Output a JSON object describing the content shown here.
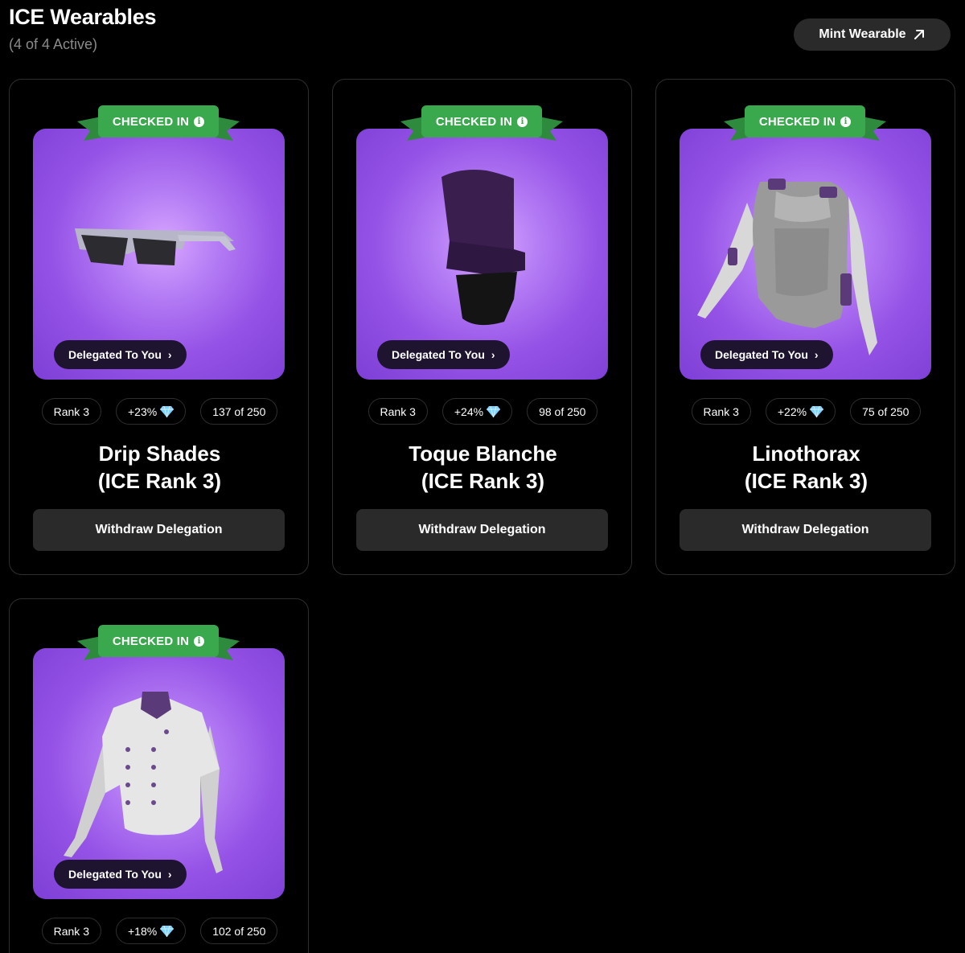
{
  "header": {
    "title": "ICE Wearables",
    "subtitle": "(4 of 4 Active)",
    "mint_label": "Mint Wearable"
  },
  "cards": [
    {
      "status": "CHECKED IN",
      "delegated_label": "Delegated To You",
      "rank": "Rank 3",
      "bonus": "+23%",
      "count": "137 of 250",
      "name": "Drip Shades",
      "rank_title": "(ICE Rank 3)",
      "withdraw_label": "Withdraw Delegation",
      "image": "sunglasses"
    },
    {
      "status": "CHECKED IN",
      "delegated_label": "Delegated To You",
      "rank": "Rank 3",
      "bonus": "+24%",
      "count": "98 of 250",
      "name": "Toque Blanche",
      "rank_title": "(ICE Rank 3)",
      "withdraw_label": "Withdraw Delegation",
      "image": "chef-hat"
    },
    {
      "status": "CHECKED IN",
      "delegated_label": "Delegated To You",
      "rank": "Rank 3",
      "bonus": "+22%",
      "count": "75 of 250",
      "name": "Linothorax",
      "rank_title": "(ICE Rank 3)",
      "withdraw_label": "Withdraw Delegation",
      "image": "armor"
    },
    {
      "status": "CHECKED IN",
      "delegated_label": "Delegated To You",
      "rank": "Rank 3",
      "bonus": "+18%",
      "count": "102 of 250",
      "name": "",
      "rank_title": "",
      "withdraw_label": "",
      "image": "chef-jacket"
    }
  ],
  "colors": {
    "ribbon_green": "#3aa84d",
    "card_purple": "#9552e6",
    "button_gray": "#2a2a2a"
  }
}
